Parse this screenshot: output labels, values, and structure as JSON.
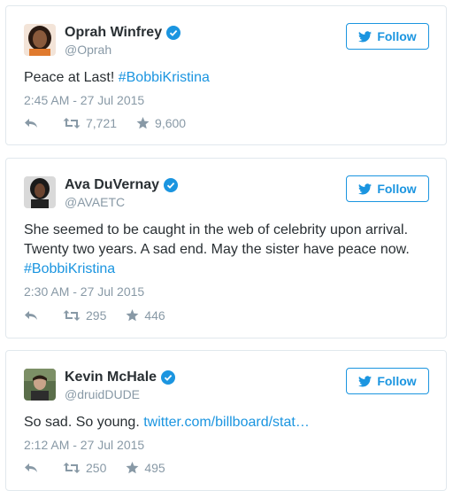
{
  "follow_label": "Follow",
  "colors": {
    "accent": "#1b95e0",
    "muted": "#8899a6",
    "text": "#292f33",
    "border": "#e1e8ed"
  },
  "tweets": [
    {
      "name": "Oprah Winfrey",
      "handle": "@Oprah",
      "text": "Peace at Last! ",
      "hashtag": "#BobbiKristina",
      "time": "2:45 AM - 27 Jul 2015",
      "retweets": "7,721",
      "likes": "9,600"
    },
    {
      "name": "Ava DuVernay",
      "handle": "@AVAETC",
      "text": "She seemed to be caught in the web of celebrity upon arrival.\nTwenty two years. A sad end. May the sister have peace now.\n",
      "hashtag": "#BobbiKristina",
      "time": "2:30 AM - 27 Jul 2015",
      "retweets": "295",
      "likes": "446"
    },
    {
      "name": "Kevin McHale",
      "handle": "@druidDUDE",
      "text": "So sad. So young. ",
      "link": "twitter.com/billboard/stat…",
      "time": "2:12 AM - 27 Jul 2015",
      "retweets": "250",
      "likes": "495"
    }
  ]
}
